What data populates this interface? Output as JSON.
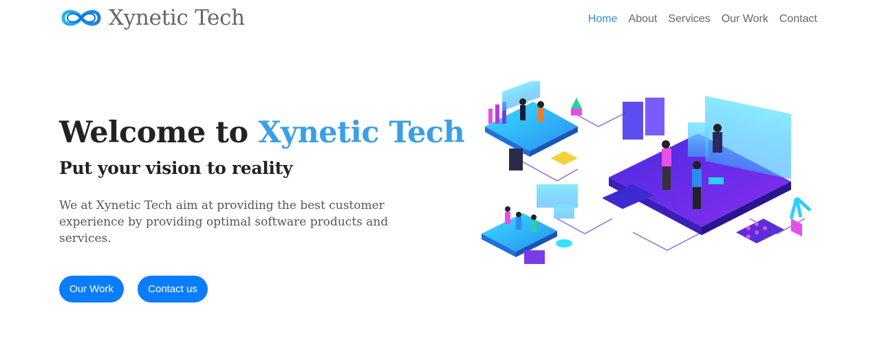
{
  "header": {
    "logo_text": "Xynetic Tech",
    "logo_icon": "infinity-icon",
    "nav": [
      {
        "label": "Home",
        "active": true
      },
      {
        "label": "About",
        "active": false
      },
      {
        "label": "Services",
        "active": false
      },
      {
        "label": "Our Work",
        "active": false
      },
      {
        "label": "Contact",
        "active": false
      }
    ]
  },
  "hero": {
    "title_prefix": "Welcome to ",
    "title_brand": "Xynetic Tech",
    "subtitle": "Put your vision to reality",
    "description": "We at Xynetic Tech aim at providing the best customer experience by providing optimal software products and services.",
    "primary_button": "Our Work",
    "secondary_button": "Contact us"
  },
  "colors": {
    "accent": "#2e8fd9",
    "brand_text": "#3a9fe6",
    "button": "#0a7cff",
    "illustration_purple": "#6a2ee8",
    "illustration_cyan": "#2ad0ff",
    "illustration_pink": "#e84ee8"
  }
}
